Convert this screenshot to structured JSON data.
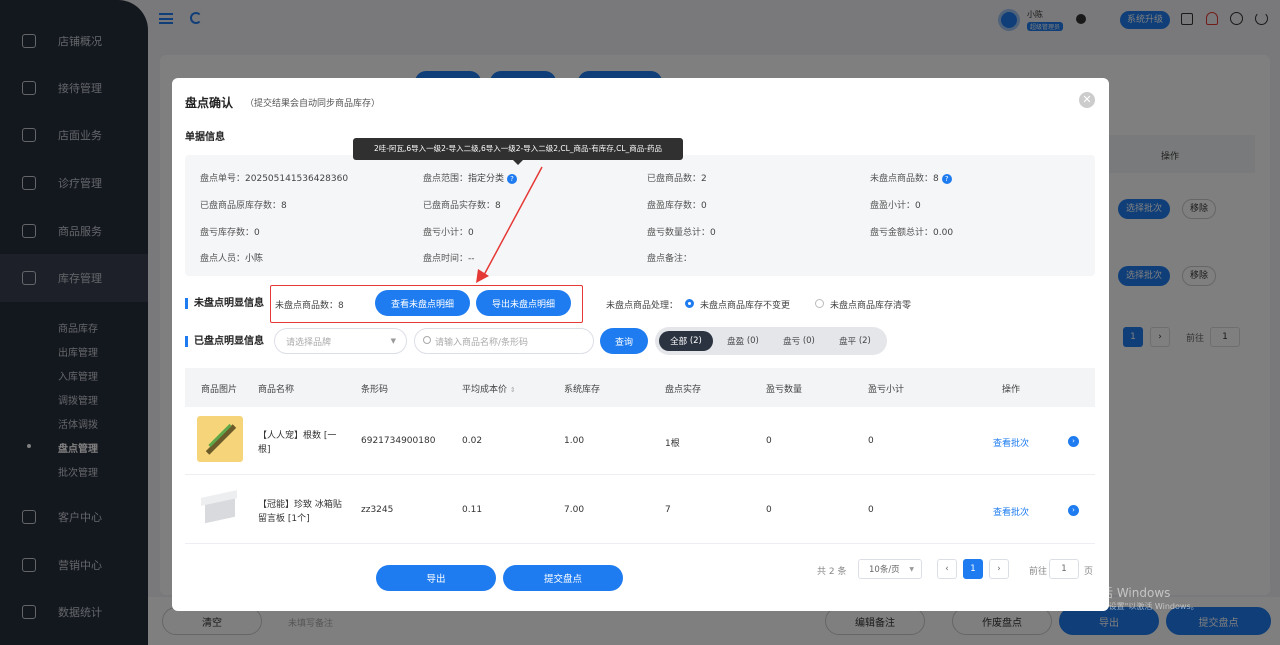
{
  "sidebar": {
    "items": [
      {
        "label": "店铺概况",
        "icon": "monitor-icon"
      },
      {
        "label": "接待管理",
        "icon": "clipboard-icon"
      },
      {
        "label": "店面业务",
        "icon": "home-icon"
      },
      {
        "label": "诊疗管理",
        "icon": "medical-icon"
      },
      {
        "label": "商品服务",
        "icon": "box-icon"
      },
      {
        "label": "库存管理",
        "icon": "warehouse-icon"
      }
    ],
    "sub_items": [
      "商品库存",
      "出库管理",
      "入库管理",
      "调拨管理",
      "活体调拨",
      "盘点管理",
      "批次管理"
    ],
    "bottom_items": [
      {
        "label": "客户中心",
        "icon": "user-icon"
      },
      {
        "label": "营销中心",
        "icon": "chart-icon"
      },
      {
        "label": "数据统计",
        "icon": "stats-icon"
      }
    ]
  },
  "topbar": {
    "user_name": "小陈",
    "user_role": "超级管理员",
    "upgrade_label": "系统升级"
  },
  "background_table": {
    "op_header": "操作",
    "rows": [
      {
        "choose_label": "选择批次",
        "remove_label": "移除"
      },
      {
        "choose_label": "选择批次",
        "remove_label": "移除"
      }
    ],
    "page": "1",
    "goto_label": "前往",
    "goto_value": "1"
  },
  "bottombar": {
    "clear_label": "清空",
    "note_placeholder": "未填写备注",
    "edit_note_label": "编辑备注",
    "void_label": "作废盘点",
    "export_label": "导出",
    "submit_label": "提交盘点"
  },
  "modal": {
    "title": "盘点确认",
    "subtitle": "（提交结果会自动同步商品库存）",
    "section_doc": "单据信息",
    "tooltip": "2哇-阿瓦,6导入一级2-导入二级,6导入一级2-导入二级2,CL_商品-有库存,CL_商品-药品",
    "info": [
      [
        {
          "k": "盘点单号：",
          "v": "202505141536428360"
        },
        {
          "k": "盘点范围：",
          "v": "指定分类"
        },
        {
          "k": "已盘商品数：",
          "v": "2"
        },
        {
          "k": "未盘点商品数：",
          "v": "8"
        }
      ],
      [
        {
          "k": "已盘商品原库存数：",
          "v": "8"
        },
        {
          "k": "已盘商品实存数：",
          "v": "8"
        },
        {
          "k": "盘盈库存数：",
          "v": "0"
        },
        {
          "k": "盘盈小计：",
          "v": "0"
        }
      ],
      [
        {
          "k": "盘亏库存数：",
          "v": "0"
        },
        {
          "k": "盘亏小计：",
          "v": "0"
        },
        {
          "k": "盘亏数量总计：",
          "v": "0"
        },
        {
          "k": "盘亏金额总计：",
          "v": "0.00"
        }
      ],
      [
        {
          "k": "盘点人员：",
          "v": "小陈"
        },
        {
          "k": "盘点时间：",
          "v": "--"
        },
        {
          "k": "盘点备注：",
          "v": ""
        },
        {
          "k": "",
          "v": ""
        }
      ]
    ],
    "uncounted": {
      "title": "未盘点明显信息",
      "count_label": "未盘点商品数：",
      "count_value": "8",
      "view_btn": "查看未盘点明细",
      "export_btn": "导出未盘点明细",
      "handling_label": "未盘点商品处理：",
      "option_keep": "未盘点商品库存不变更",
      "option_clear": "未盘点商品库存清零"
    },
    "counted": {
      "title": "已盘点明显信息",
      "brand_placeholder": "请选择品牌",
      "search_placeholder": "请输入商品名称/条形码",
      "query_btn": "查询",
      "tabs": [
        {
          "label": "全部",
          "count": "(2)"
        },
        {
          "label": "盘盈",
          "count": "(0)"
        },
        {
          "label": "盘亏",
          "count": "(0)"
        },
        {
          "label": "盘平",
          "count": "(2)"
        }
      ]
    },
    "table": {
      "headers": [
        "商品图片",
        "商品名称",
        "条形码",
        "平均成本价",
        "系统库存",
        "盘点实存",
        "盈亏数量",
        "盈亏小计",
        "操作"
      ],
      "rows": [
        {
          "name": "【人人宠】根数 [一根]",
          "barcode": "6921734900180",
          "avg_cost": "0.02",
          "sys_stock": "1.00",
          "actual": "1根",
          "diff_qty": "0",
          "diff_sub": "0",
          "action": "查看批次"
        },
        {
          "name": "【冠能】珍致 冰箱贴留言板 [1个]",
          "barcode": "zz3245",
          "avg_cost": "0.11",
          "sys_stock": "7.00",
          "actual": "7",
          "diff_qty": "0",
          "diff_sub": "0",
          "action": "查看批次"
        }
      ]
    },
    "pagination": {
      "total": "共 2 条",
      "page_size": "10条/页",
      "current": "1",
      "goto_label": "前往",
      "goto_value": "1",
      "page_suffix": "页"
    },
    "export_btn": "导出",
    "submit_btn": "提交盘点"
  },
  "watermark": {
    "line1": "激活 Windows",
    "line2": "转到\"设置\"以激活 Windows。"
  },
  "colors": {
    "accent": "#1e7cf0",
    "sidebar": "#272e3c",
    "highlight": "#e53935"
  }
}
